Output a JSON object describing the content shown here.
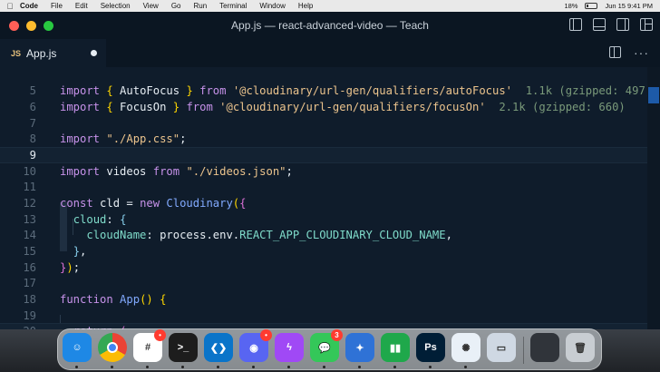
{
  "menubar": {
    "apple_icon": "apple-icon",
    "app_name": "Code",
    "items": [
      "File",
      "Edit",
      "Selection",
      "View",
      "Go",
      "Run",
      "Terminal",
      "Window",
      "Help"
    ],
    "battery": "18%",
    "datetime": "Jun 15  9:41 PM"
  },
  "window": {
    "title": "App.js — react-advanced-video — Teach",
    "traffic_lights": {
      "close": "#ff5f57",
      "minimize": "#febc2e",
      "zoom": "#28c840"
    }
  },
  "tabs": [
    {
      "icon_label": "JS",
      "label": "App.js",
      "modified": true
    }
  ],
  "editor": {
    "current_line": 9,
    "line_numbers": [
      "5",
      "6",
      "7",
      "8",
      "9",
      "10",
      "11",
      "12",
      "13",
      "14",
      "15",
      "16",
      "17",
      "18",
      "19",
      "20"
    ]
  },
  "hints": {
    "autofocus": "1.1k (gzipped: 497)",
    "focuson": "2.1k (gzipped: 660)"
  },
  "dock": {
    "apps": [
      {
        "name": "Finder",
        "color": "#1e88e5",
        "glyph": "☺",
        "badge": "",
        "running": true
      },
      {
        "name": "Chrome",
        "color": "#f5f5f5",
        "glyph": "",
        "badge": "",
        "running": true
      },
      {
        "name": "Slack",
        "color": "#ffffff",
        "glyph": "#",
        "badge": "•",
        "running": true
      },
      {
        "name": "Terminal",
        "color": "#1d1d1d",
        "glyph": ">_",
        "badge": "",
        "running": true
      },
      {
        "name": "VS Code",
        "color": "#0a74c9",
        "glyph": "❮❯",
        "badge": "",
        "running": true
      },
      {
        "name": "Discord",
        "color": "#5865f2",
        "glyph": "◉",
        "badge": "•",
        "running": true
      },
      {
        "name": "Messenger",
        "color": "#a049f5",
        "glyph": "ϟ",
        "badge": "",
        "running": true
      },
      {
        "name": "Messages",
        "color": "#34c759",
        "glyph": "💬",
        "badge": "3",
        "running": true
      },
      {
        "name": "Keynote-like",
        "color": "#2f72d6",
        "glyph": "✦",
        "badge": "",
        "running": true
      },
      {
        "name": "Numbers",
        "color": "#1fa84b",
        "glyph": "▮▮",
        "badge": "",
        "running": true
      },
      {
        "name": "Photoshop",
        "color": "#001e36",
        "glyph": "Ps",
        "badge": "",
        "running": true
      },
      {
        "name": "Pinwheel",
        "color": "#e9f0f7",
        "glyph": "✺",
        "badge": "",
        "running": true
      },
      {
        "name": "Preview",
        "color": "#cfd8e3",
        "glyph": "▭",
        "badge": "",
        "running": false
      },
      {
        "name": "Window thumbnail",
        "color": "#30343a",
        "glyph": "",
        "badge": "",
        "running": false
      },
      {
        "name": "Trash",
        "color": "#c8cdd2",
        "glyph": "🗑",
        "badge": "",
        "running": false
      }
    ]
  }
}
